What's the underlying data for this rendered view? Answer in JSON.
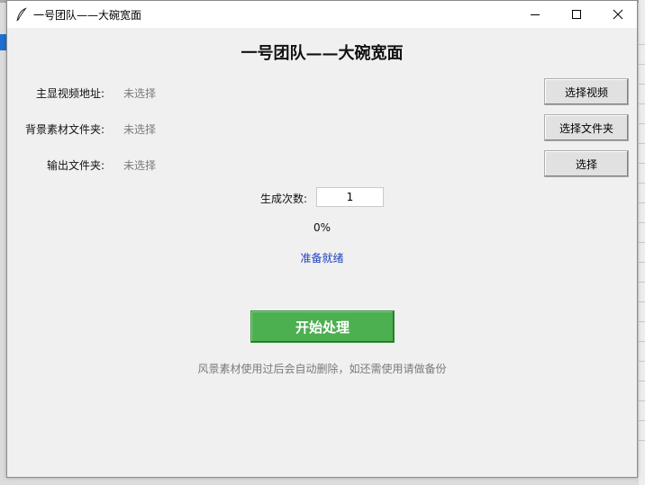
{
  "window": {
    "title": "一号团队——大碗宽面"
  },
  "header": {
    "title": "一号团队——大碗宽面"
  },
  "rows": [
    {
      "label": "主显视频地址:",
      "value": "未选择",
      "button": "选择视频"
    },
    {
      "label": "背景素材文件夹:",
      "value": "未选择",
      "button": "选择文件夹"
    },
    {
      "label": "输出文件夹:",
      "value": "未选择",
      "button": "选择"
    }
  ],
  "generation": {
    "label": "生成次数:",
    "count": "1"
  },
  "progress": {
    "percent_text": "0%"
  },
  "status": {
    "text": "准备就绪"
  },
  "start_button": {
    "label": "开始处理"
  },
  "note": {
    "text": "风景素材使用过后会自动删除，如还需使用请做备份"
  },
  "colors": {
    "accent_green": "#4caf50",
    "status_blue": "#1c3fbf",
    "placeholder_gray": "#7a7a7a"
  }
}
